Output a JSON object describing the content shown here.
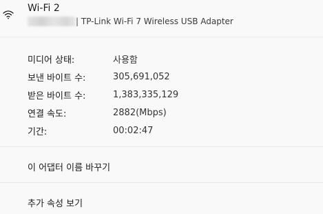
{
  "adapter": {
    "name": "Wi-Fi 2",
    "description": "| TP-Link Wi-Fi 7 Wireless USB Adapter",
    "icon": "wifi-icon"
  },
  "properties": [
    {
      "label": "미디어 상태:",
      "value": "사용함"
    },
    {
      "label": "보낸 바이트 수:",
      "value": "305,691,052"
    },
    {
      "label": "받은 바이트 수:",
      "value": "1,383,335,129"
    },
    {
      "label": "연결 속도:",
      "value": "2882(Mbps)"
    },
    {
      "label": "기간:",
      "value": "00:02:47"
    }
  ],
  "actions": {
    "rename": "이 어댑터 이름 바꾸기",
    "more_properties": "추가 속성 보기"
  }
}
